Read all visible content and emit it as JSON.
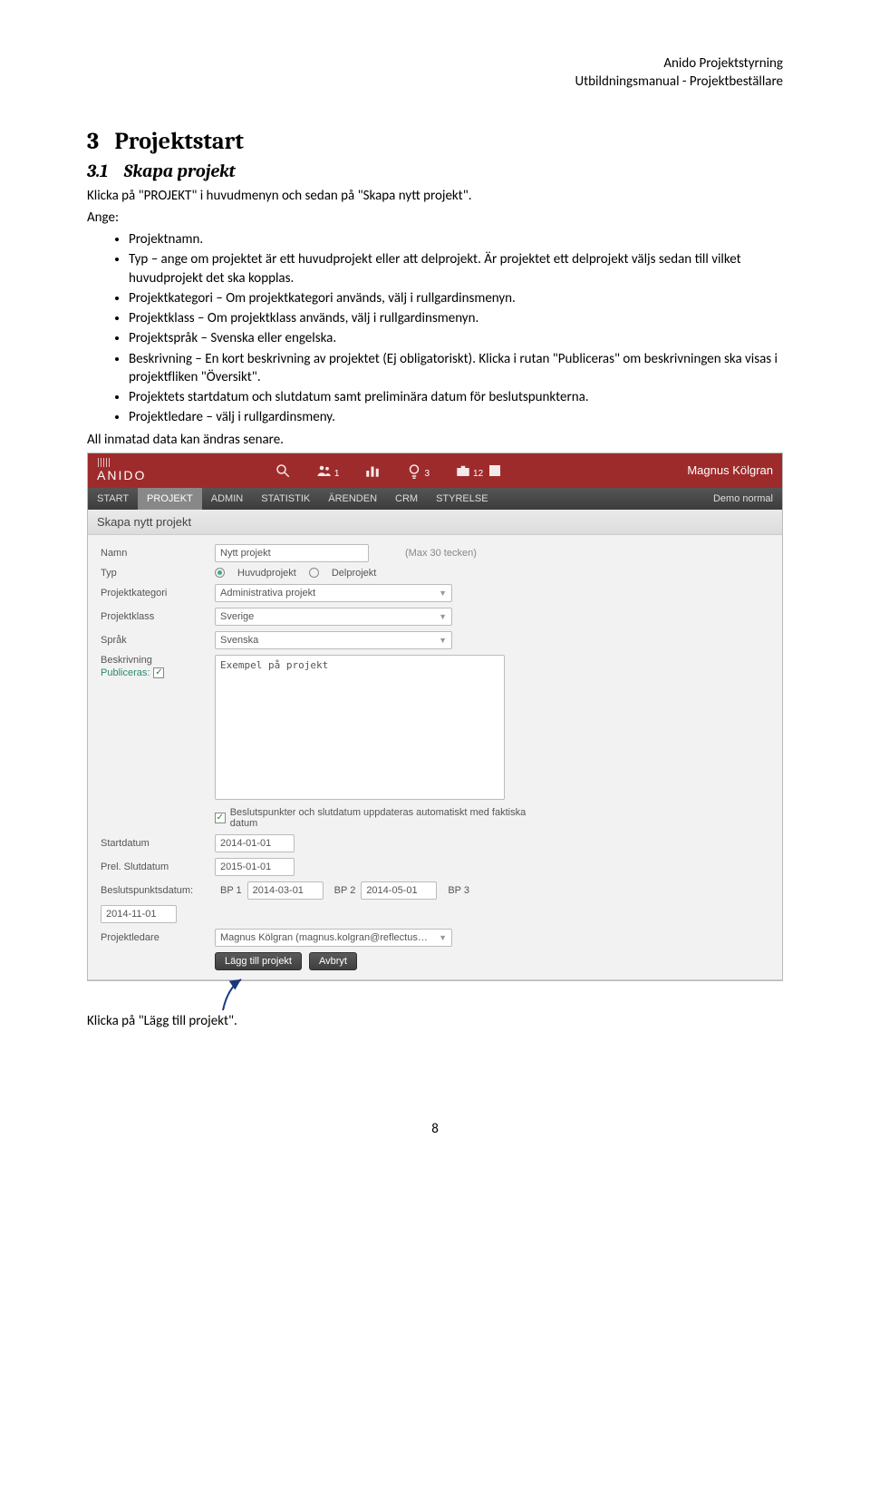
{
  "header": {
    "line1": "Anido Projektstyrning",
    "line2": "Utbildningsmanual - Projektbeställare"
  },
  "section": {
    "num": "3",
    "title": "Projektstart",
    "sub_num": "3.1",
    "sub_title": "Skapa projekt",
    "intro": "Klicka på \"PROJEKT\" i huvudmenyn och sedan på \"Skapa nytt projekt\".",
    "ange": "Ange:",
    "bullets": [
      "Projektnamn.",
      "Typ – ange om projektet är ett huvudprojekt eller att delprojekt. Är projektet ett delprojekt väljs sedan till vilket huvudprojekt det ska kopplas.",
      "Projektkategori – Om projektkategori används, välj i rullgardinsmenyn.",
      "Projektklass – Om projektklass används, välj i rullgardinsmenyn.",
      "Projektspråk – Svenska eller engelska.",
      "Beskrivning – En kort beskrivning av projektet (Ej obligatoriskt). Klicka i rutan \"Publiceras\" om beskrivningen ska visas i projektfliken \"Översikt\".",
      "Projektets startdatum och slutdatum samt preliminära datum för beslutspunkterna.",
      "Projektledare – välj i rullgardinsmeny."
    ],
    "outro": "All inmatad data kan ändras senare.",
    "click_text": "Klicka på \"Lägg till projekt\"."
  },
  "app": {
    "logo": "ANIDO",
    "icons": [
      {
        "name": "search-icon",
        "badge": ""
      },
      {
        "name": "people-icon",
        "badge": "1"
      },
      {
        "name": "bars-icon",
        "badge": ""
      },
      {
        "name": "bulb-icon",
        "badge": "3"
      },
      {
        "name": "briefcase-icon",
        "badge": "12"
      }
    ],
    "user": "Magnus Kölgran",
    "nav": [
      "START",
      "PROJEKT",
      "ADMIN",
      "STATISTIK",
      "ÄRENDEN",
      "CRM",
      "STYRELSE"
    ],
    "nav_right": "Demo normal",
    "panel_title": "Skapa nytt projekt",
    "form": {
      "name_label": "Namn",
      "name_value": "Nytt projekt",
      "name_hint": "(Max 30 tecken)",
      "type_label": "Typ",
      "type_opt1": "Huvudprojekt",
      "type_opt2": "Delprojekt",
      "cat_label": "Projektkategori",
      "cat_value": "Administrativa projekt",
      "class_label": "Projektklass",
      "class_value": "Sverige",
      "lang_label": "Språk",
      "lang_value": "Svenska",
      "desc_label": "Beskrivning",
      "pub_label": "Publiceras:",
      "desc_value": "Exempel på projekt",
      "auto_note": "Beslutspunkter och slutdatum uppdateras automatiskt med faktiska datum",
      "start_label": "Startdatum",
      "start_value": "2014-01-01",
      "end_label": "Prel. Slutdatum",
      "end_value": "2015-01-01",
      "bp_label": "Beslutspunktsdatum:",
      "bp1_l": "BP 1",
      "bp1_v": "2014-03-01",
      "bp2_l": "BP 2",
      "bp2_v": "2014-05-01",
      "bp3_l": "BP 3",
      "bp3_v": "2014-11-01",
      "pl_label": "Projektledare",
      "pl_value": "Magnus Kölgran (magnus.kolgran@reflectus…",
      "btn_add": "Lägg till projekt",
      "btn_cancel": "Avbryt"
    }
  },
  "page_number": "8"
}
